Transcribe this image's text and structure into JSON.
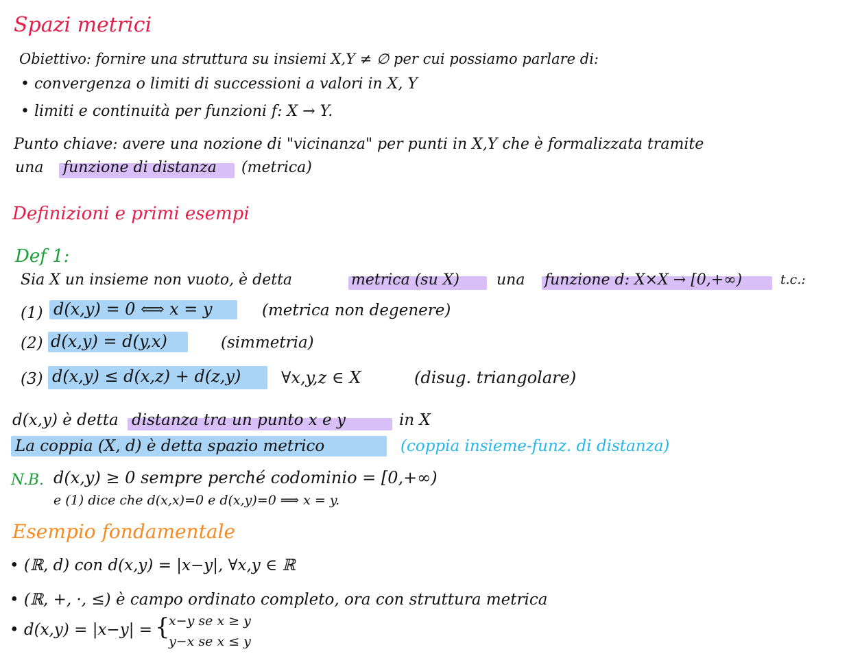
{
  "title": "Spazi metrici",
  "intro": {
    "objective": "Obiettivo: fornire una struttura su insiemi X,Y ≠ ∅ per cui possiamo parlare di:",
    "bullet_1": "• convergenza o limiti di successioni a valori in X, Y",
    "bullet_2": "• limiti e continuità per funzioni f: X → Y.",
    "key_point": "Punto chiave: avere una nozione di \"vicinanza\" per punti in X,Y che è formalizzata tramite",
    "key_point_prefix": "una",
    "key_point_highlight": "funzione di distanza",
    "key_point_suffix": "(metrica)"
  },
  "section_definitions": {
    "heading": "Definizioni e primi esempi",
    "def_label": "Def 1:",
    "def_intro_prefix": "Sia X un insieme non vuoto, è detta",
    "def_intro_metric": "metrica (su X)",
    "def_intro_mid": "una",
    "def_intro_function": "funzione d: X×X → [0,+∞)",
    "def_intro_suffix": "t.c.:",
    "axioms": [
      {
        "number": "(1)",
        "formula": "d(x,y) = 0 ⟺ x = y",
        "note": "(metrica non degenere)"
      },
      {
        "number": "(2)",
        "formula": "d(x,y) = d(y,x)",
        "note": "(simmetria)"
      },
      {
        "number": "(3)",
        "formula": "d(x,y) ≤ d(x,z) + d(z,y)",
        "quantifier": "∀x,y,z ∈ X",
        "note": "(disug. triangolare)"
      }
    ],
    "distance_prefix": "d(x,y) è detta",
    "distance_highlight": "distanza tra un punto x e y",
    "distance_suffix": "in X",
    "pair_highlight": "La coppia (X, d) è detta spazio metrico",
    "pair_note": "(coppia insieme-funz. di distanza)",
    "nb_label": "N.B.",
    "nb_text": "d(x,y) ≥ 0 sempre perché codominio = [0,+∞)",
    "nb_text_2": "e (1) dice che d(x,x)=0 e d(x,y)=0 ⟹ x = y."
  },
  "section_example": {
    "heading": "Esempio fondamentale",
    "item_1": "• (ℝ, d) con d(x,y) = |x−y|, ∀x,y ∈ ℝ",
    "item_2": "• (ℝ, +, ·, ≤) è campo ordinato completo, ora con struttura metrica",
    "item_3_prefix": "• d(x,y) = |x−y| =",
    "case_1": "x−y  se x ≥ y",
    "case_2": "y−x  se x ≤ y"
  },
  "colors": {
    "red": "#e0204a",
    "orange": "#f58a24",
    "green": "#1e9e3a",
    "cyan": "#24b6ea",
    "highlight_purple": "#d9bff7",
    "highlight_blue": "#aad4f5"
  }
}
